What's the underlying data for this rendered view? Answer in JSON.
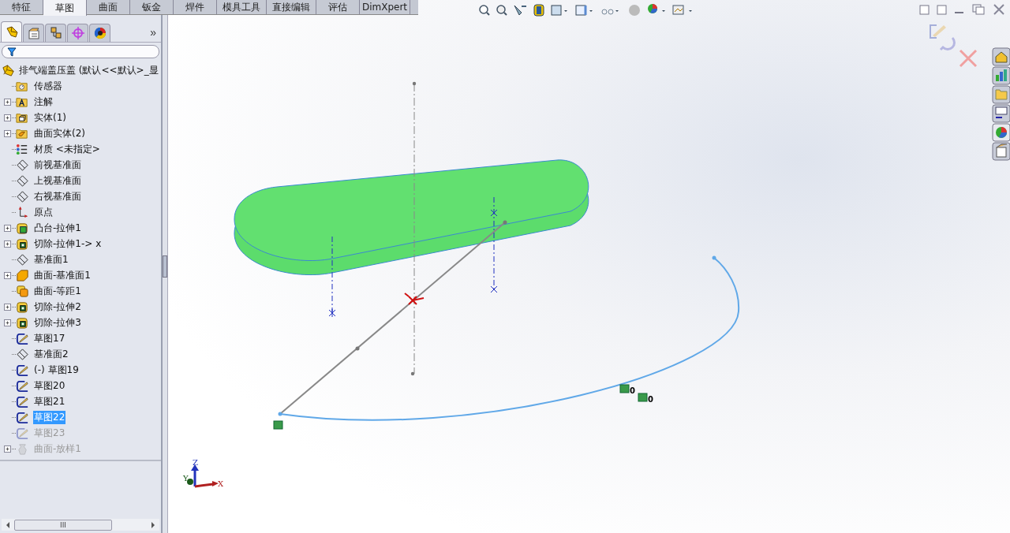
{
  "command_tabs": [
    {
      "label": "特征",
      "selected": false
    },
    {
      "label": "草图",
      "selected": true
    },
    {
      "label": "曲面",
      "selected": false
    },
    {
      "label": "钣金",
      "selected": false
    },
    {
      "label": "焊件",
      "selected": false
    },
    {
      "label": "模具工具",
      "selected": false
    },
    {
      "label": "直接编辑",
      "selected": false
    },
    {
      "label": "评估",
      "selected": false
    },
    {
      "label": "DimXpert",
      "selected": false
    }
  ],
  "panel_tabs": [
    {
      "kind": "feature-tree",
      "selected": true
    },
    {
      "kind": "property",
      "selected": false
    },
    {
      "kind": "config",
      "selected": false
    },
    {
      "kind": "dimxpert",
      "selected": false
    },
    {
      "kind": "display",
      "selected": false
    }
  ],
  "panel_more": "»",
  "tree": {
    "label": "排气端盖压盖 (默认<<默认>_显",
    "children": [
      {
        "label": "传感器",
        "kind": "sensor",
        "expander": false,
        "selected": false,
        "disabled": false
      },
      {
        "label": "注解",
        "kind": "annotation",
        "expander": true,
        "selected": false,
        "disabled": false
      },
      {
        "label": "实体(1)",
        "kind": "solid",
        "expander": true,
        "selected": false,
        "disabled": false
      },
      {
        "label": "曲面实体(2)",
        "kind": "surface-body",
        "expander": true,
        "selected": false,
        "disabled": false
      },
      {
        "label": "材质 <未指定>",
        "kind": "material",
        "expander": false,
        "selected": false,
        "disabled": false
      },
      {
        "label": "前视基准面",
        "kind": "plane",
        "expander": false,
        "selected": false,
        "disabled": false
      },
      {
        "label": "上视基准面",
        "kind": "plane",
        "expander": false,
        "selected": false,
        "disabled": false
      },
      {
        "label": "右视基准面",
        "kind": "plane",
        "expander": false,
        "selected": false,
        "disabled": false
      },
      {
        "label": "原点",
        "kind": "origin",
        "expander": false,
        "selected": false,
        "disabled": false
      },
      {
        "label": "凸台-拉伸1",
        "kind": "boss",
        "expander": true,
        "selected": false,
        "disabled": false
      },
      {
        "label": "切除-拉伸1-> x",
        "kind": "cut",
        "expander": true,
        "selected": false,
        "disabled": false
      },
      {
        "label": "基准面1",
        "kind": "plane",
        "expander": false,
        "selected": false,
        "disabled": false
      },
      {
        "label": "曲面-基准面1",
        "kind": "surface-plane",
        "expander": true,
        "selected": false,
        "disabled": false
      },
      {
        "label": "曲面-等距1",
        "kind": "surface-offset",
        "expander": false,
        "selected": false,
        "disabled": false
      },
      {
        "label": "切除-拉伸2",
        "kind": "cut",
        "expander": true,
        "selected": false,
        "disabled": false
      },
      {
        "label": "切除-拉伸3",
        "kind": "cut",
        "expander": true,
        "selected": false,
        "disabled": false
      },
      {
        "label": "草图17",
        "kind": "sketch",
        "expander": false,
        "selected": false,
        "disabled": false
      },
      {
        "label": "基准面2",
        "kind": "plane",
        "expander": false,
        "selected": false,
        "disabled": false
      },
      {
        "label": "(-) 草图19",
        "kind": "sketch",
        "expander": false,
        "selected": false,
        "disabled": false
      },
      {
        "label": "草图20",
        "kind": "sketch",
        "expander": false,
        "selected": false,
        "disabled": false
      },
      {
        "label": "草图21",
        "kind": "sketch",
        "expander": false,
        "selected": false,
        "disabled": false
      },
      {
        "label": "草图22",
        "kind": "sketch",
        "expander": false,
        "selected": true,
        "disabled": false
      },
      {
        "label": "草图23",
        "kind": "sketch",
        "expander": false,
        "selected": false,
        "disabled": true
      },
      {
        "label": "曲面-放样1",
        "kind": "loft",
        "expander": true,
        "selected": false,
        "disabled": true
      }
    ]
  },
  "scrollbar_grip": "III",
  "viewport": {
    "relation_labels": [
      "0",
      "0"
    ],
    "triad": {
      "z": "Z",
      "y": "Y",
      "x": "X"
    }
  }
}
